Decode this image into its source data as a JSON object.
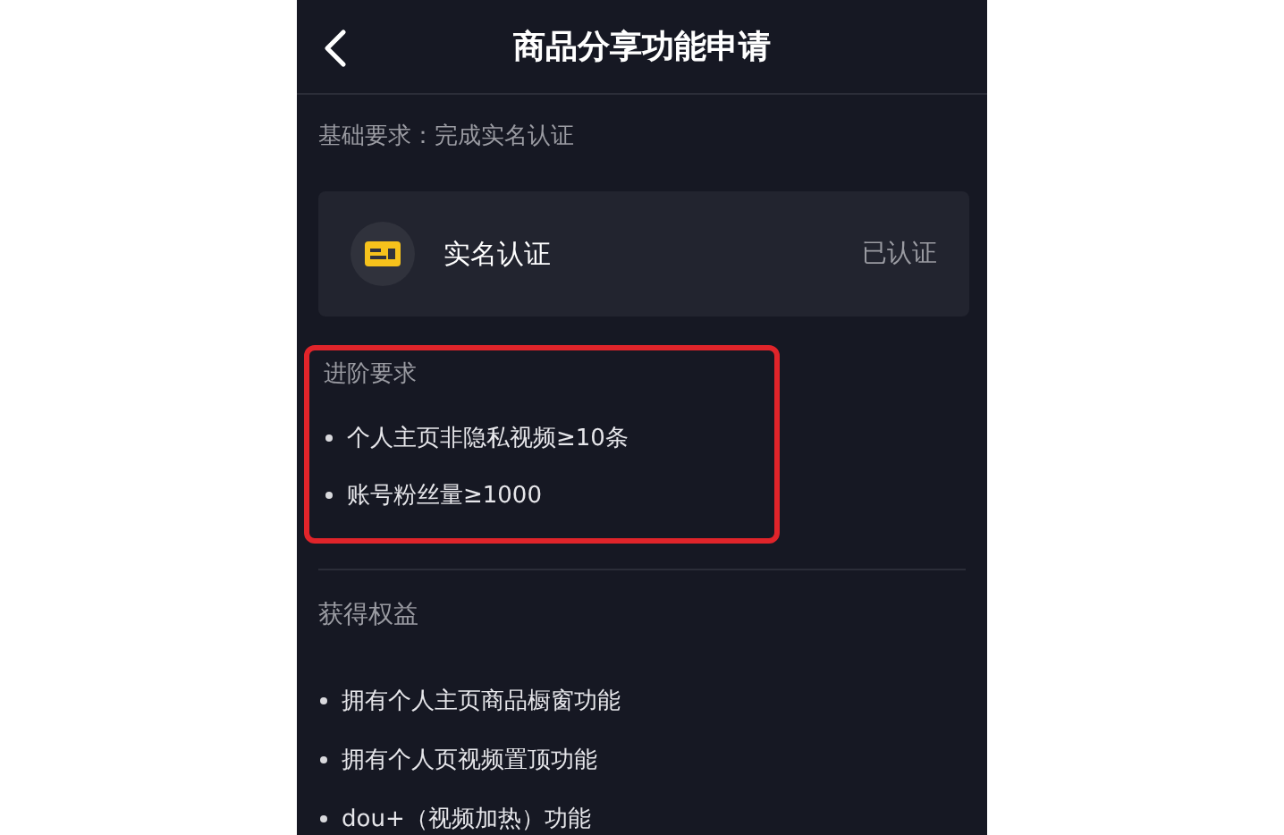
{
  "header": {
    "title": "商品分享功能申请"
  },
  "basic_requirement": "基础要求：完成实名认证",
  "verification_card": {
    "label": "实名认证",
    "status": "已认证"
  },
  "advanced": {
    "title": "进阶要求",
    "highlighted": true,
    "items": [
      "个人主页非隐私视频≥10条",
      "账号粉丝量≥1000"
    ]
  },
  "benefits": {
    "title": "获得权益",
    "items": [
      "拥有个人主页商品橱窗功能",
      "拥有个人页视频置顶功能",
      "dou+（视频加热）功能"
    ]
  }
}
